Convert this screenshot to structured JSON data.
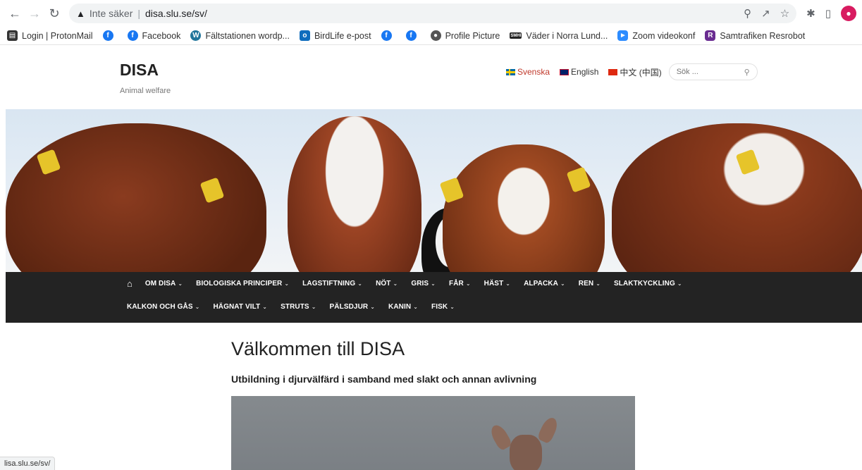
{
  "browser": {
    "security_label": "Inte säker",
    "url": "disa.slu.se/sv/",
    "status_url": "lisa.slu.se/sv/"
  },
  "bookmarks": [
    {
      "label": "Login | ProtonMail",
      "icon": "protonmail-icon"
    },
    {
      "label": "",
      "icon": "facebook-icon"
    },
    {
      "label": "Facebook",
      "icon": "facebook-icon"
    },
    {
      "label": "Fältstationen wordp...",
      "icon": "wordpress-icon"
    },
    {
      "label": "BirdLife e-post",
      "icon": "outlook-icon"
    },
    {
      "label": "",
      "icon": "facebook-icon"
    },
    {
      "label": "",
      "icon": "facebook-icon"
    },
    {
      "label": "Profile Picture",
      "icon": "globe-icon"
    },
    {
      "label": "Väder i Norra Lund...",
      "icon": "smhi-icon"
    },
    {
      "label": "Zoom videokonf",
      "icon": "zoom-icon"
    },
    {
      "label": "Samtrafiken Resrobot",
      "icon": "resrobot-icon"
    }
  ],
  "site": {
    "title": "DISA",
    "description": "Animal welfare"
  },
  "languages": [
    {
      "label": "Svenska",
      "active": true
    },
    {
      "label": "English",
      "active": false
    },
    {
      "label": "中文 (中国)",
      "active": false
    }
  ],
  "search": {
    "placeholder": "Sök ..."
  },
  "nav": {
    "row1": [
      "OM DISA",
      "BIOLOGISKA PRINCIPER",
      "LAGSTIFTNING",
      "NÖT",
      "GRIS",
      "FÅR",
      "HÄST",
      "ALPACKA",
      "REN",
      "SLAKTKYCKLING"
    ],
    "row2": [
      "KALKON OCH GÅS",
      "HÄGNAT VILT",
      "STRUTS",
      "PÄLSDJUR",
      "KANIN",
      "FISK"
    ]
  },
  "content": {
    "page_title": "Välkommen till DISA",
    "subtitle": "Utbildning i djurvälfärd i samband med slakt och annan avlivning"
  },
  "colors": {
    "nav_bg": "#232323",
    "active_lang": "#c0392b"
  }
}
